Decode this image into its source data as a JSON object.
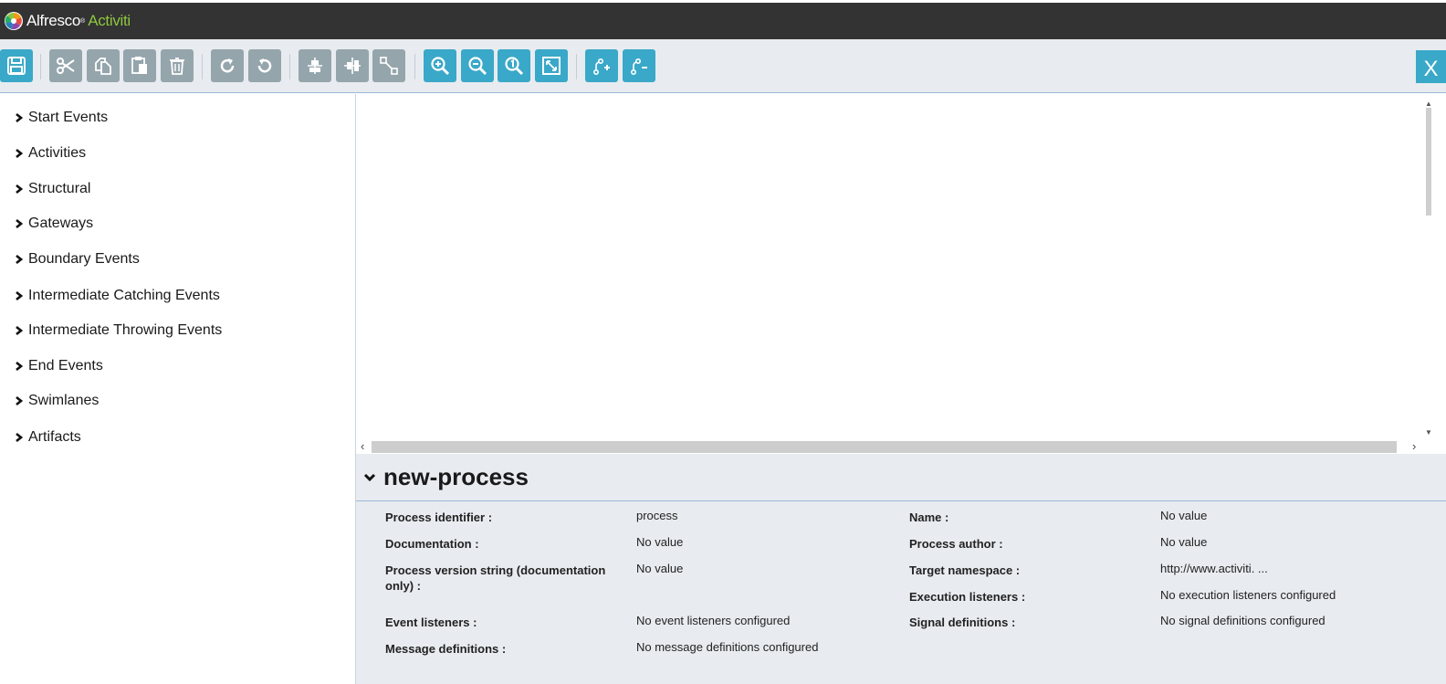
{
  "header": {
    "logo_brand": "Alfresco",
    "logo_product": "Activiti",
    "logo_mark": "®"
  },
  "toolbar": {
    "close_label": "X",
    "buttons": [
      {
        "name": "save-icon"
      },
      {
        "name": "cut-icon"
      },
      {
        "name": "copy-icon"
      },
      {
        "name": "paste-icon"
      },
      {
        "name": "delete-icon"
      },
      {
        "name": "redo-icon"
      },
      {
        "name": "undo-icon"
      },
      {
        "name": "align-vertical-icon"
      },
      {
        "name": "align-horizontal-icon"
      },
      {
        "name": "same-size-icon"
      },
      {
        "name": "zoom-in-icon"
      },
      {
        "name": "zoom-out-icon"
      },
      {
        "name": "zoom-actual-icon"
      },
      {
        "name": "zoom-fit-icon"
      },
      {
        "name": "add-bendpoint-icon"
      },
      {
        "name": "remove-bendpoint-icon"
      }
    ]
  },
  "palette": {
    "items": [
      {
        "label": "Start Events"
      },
      {
        "label": "Activities"
      },
      {
        "label": "Structural"
      },
      {
        "label": "Gateways"
      },
      {
        "label": "Boundary Events"
      },
      {
        "label": "Intermediate Catching Events"
      },
      {
        "label": "Intermediate Throwing Events"
      },
      {
        "label": "End Events"
      },
      {
        "label": "Swimlanes"
      },
      {
        "label": "Artifacts"
      }
    ]
  },
  "properties": {
    "title": "new-process",
    "left": [
      {
        "label": "Process identifier :",
        "value": "process"
      },
      {
        "label": "Documentation :",
        "value": "No value"
      },
      {
        "label": "Process version string (documentation only) :",
        "value": "No value"
      },
      {
        "label": "Event listeners :",
        "value": "No event listeners configured"
      },
      {
        "label": "Message definitions :",
        "value": "No message definitions configured"
      }
    ],
    "right": [
      {
        "label": "Name :",
        "value": "No value"
      },
      {
        "label": "Process author :",
        "value": "No value"
      },
      {
        "label": "Target namespace :",
        "value": "http://www.activiti. ..."
      },
      {
        "label": "Execution listeners :",
        "value": "No execution listeners configured"
      },
      {
        "label": "Signal definitions :",
        "value": "No signal definitions configured"
      }
    ]
  }
}
